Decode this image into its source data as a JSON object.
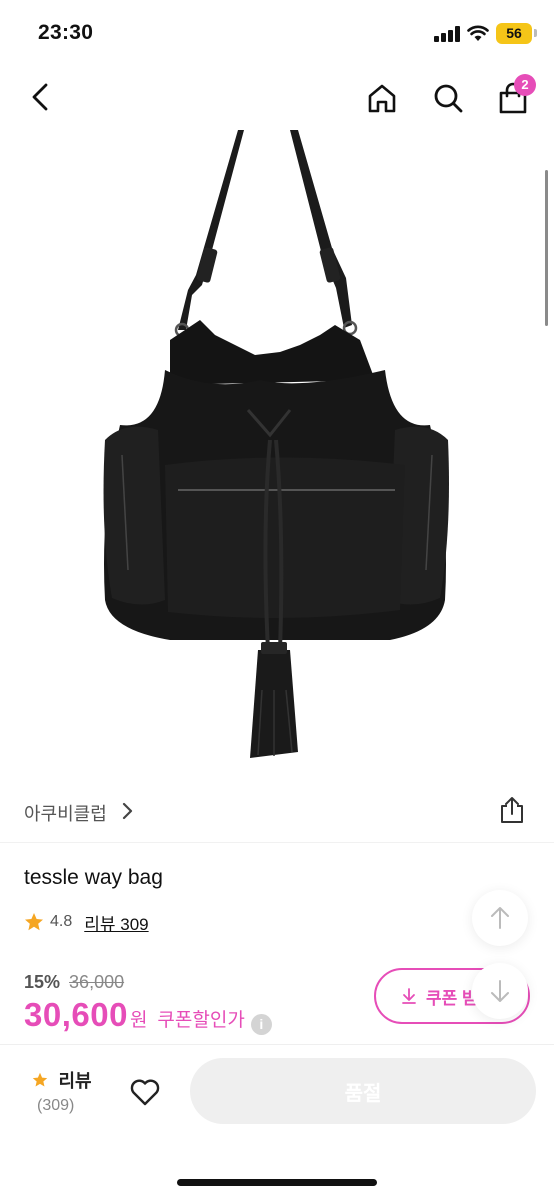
{
  "status_bar": {
    "time": "23:30",
    "battery_level": "56"
  },
  "header": {
    "cart_count": "2"
  },
  "icons": {
    "back": "chevron-left-icon",
    "home": "home-icon",
    "search": "search-icon",
    "cart": "shopping-bag-icon",
    "share": "share-icon",
    "star": "star-icon",
    "heart": "heart-icon",
    "arrow_up": "arrow-up-icon",
    "arrow_down": "arrow-down-icon",
    "download": "download-icon",
    "info": "info-icon"
  },
  "product": {
    "image_alt": "black leather drawstring bucket bag with tassel",
    "brand": "아쿠비클럽",
    "title": "tessle way bag",
    "rating": "4.8",
    "review_link": "리뷰 309",
    "discount_rate": "15%",
    "original_price": "36,000",
    "sale_price": "30,600",
    "currency": "원",
    "coupon_price_label": "쿠폰할인가",
    "info_mark": "i",
    "coupon_button_label": "쿠폰 받기"
  },
  "bottom_bar": {
    "review_label": "리뷰",
    "review_count": "(309)",
    "purchase_button_label": "품절"
  },
  "colors": {
    "accent": "#e64db8",
    "star": "#f5a623",
    "battery": "#f5c518",
    "disabled_button": "#efefef"
  }
}
